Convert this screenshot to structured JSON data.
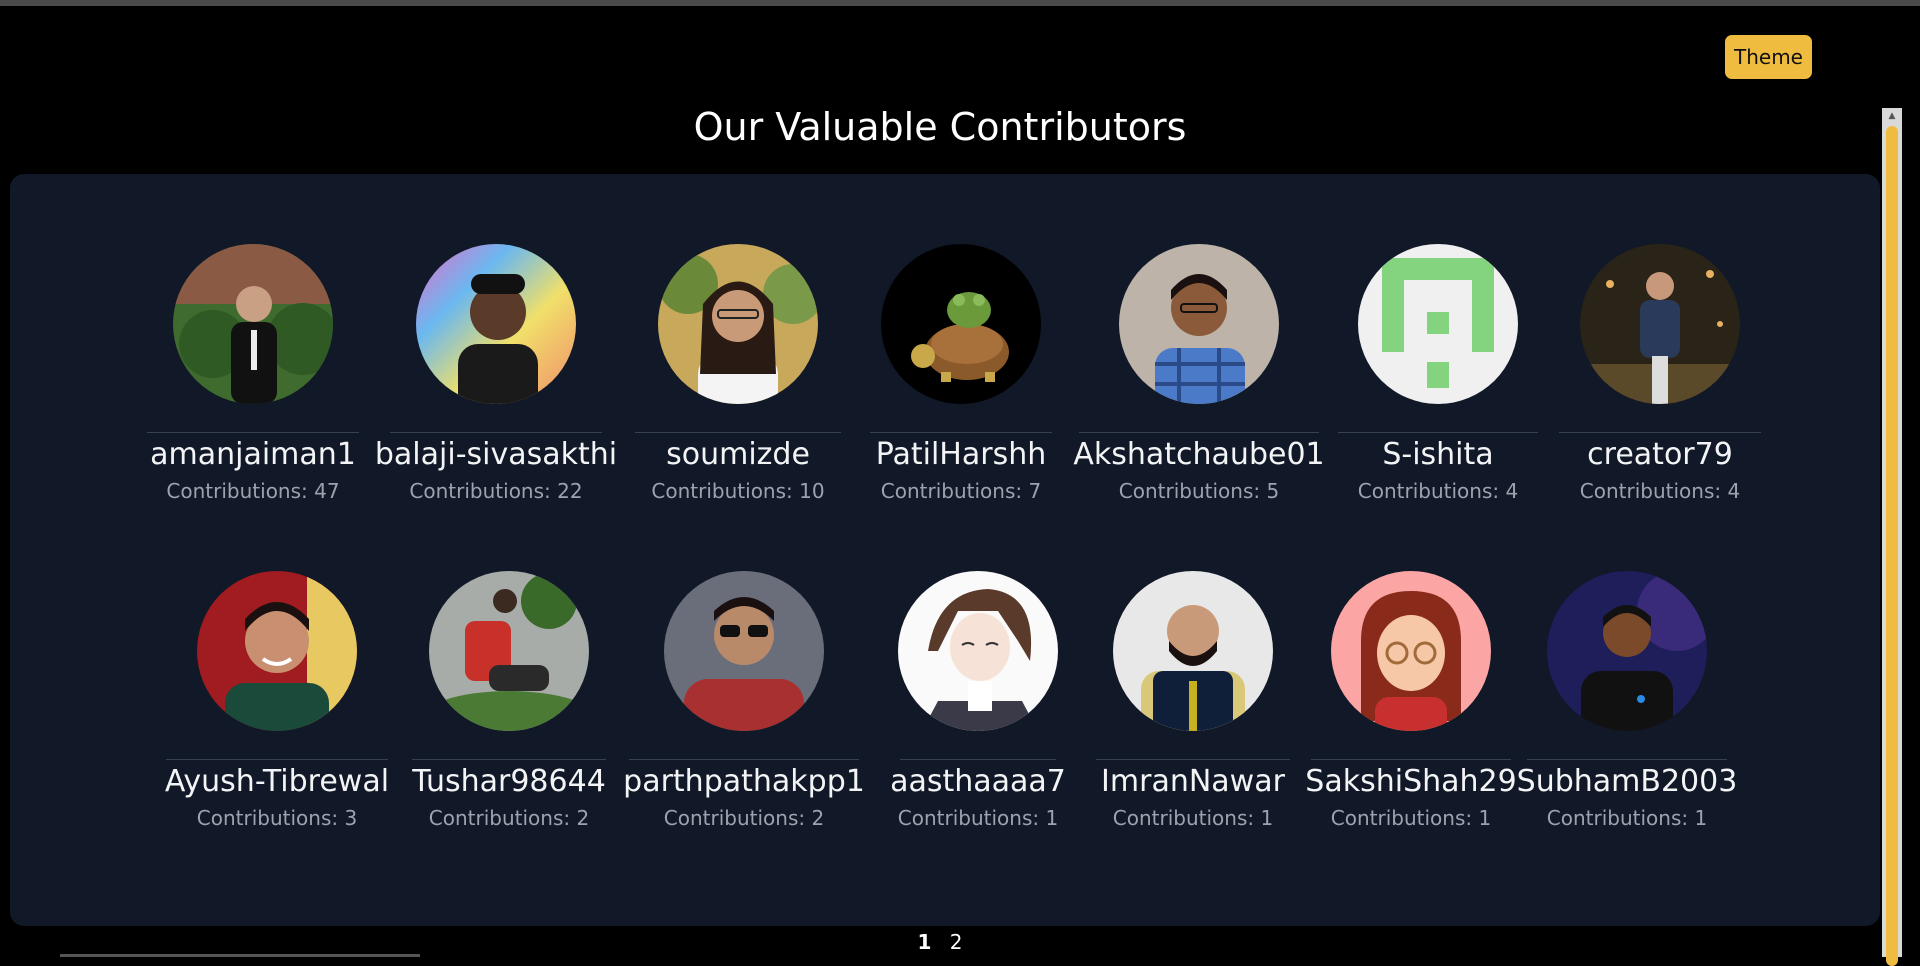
{
  "header": {
    "theme_button": "Theme",
    "title": "Our Valuable Contributors"
  },
  "contributors": [
    {
      "name": "amanjaiman1",
      "contributions": "Contributions: 47",
      "avatar_icon": "person-photo-avatar"
    },
    {
      "name": "balaji-sivasakthi",
      "contributions": "Contributions: 22",
      "avatar_icon": "person-photo-avatar"
    },
    {
      "name": "soumizde",
      "contributions": "Contributions: 10",
      "avatar_icon": "person-photo-avatar"
    },
    {
      "name": "PatilHarshh",
      "contributions": "Contributions: 7",
      "avatar_icon": "frog-on-turtle-avatar"
    },
    {
      "name": "Akshatchaube01",
      "contributions": "Contributions: 5",
      "avatar_icon": "person-photo-avatar"
    },
    {
      "name": "S-ishita",
      "contributions": "Contributions: 4",
      "avatar_icon": "identicon-avatar"
    },
    {
      "name": "creator79",
      "contributions": "Contributions: 4",
      "avatar_icon": "person-photo-avatar"
    },
    {
      "name": "Ayush-Tibrewal",
      "contributions": "Contributions: 3",
      "avatar_icon": "person-photo-avatar"
    },
    {
      "name": "Tushar98644",
      "contributions": "Contributions: 2",
      "avatar_icon": "person-photo-avatar"
    },
    {
      "name": "parthpathakpp1",
      "contributions": "Contributions: 2",
      "avatar_icon": "person-photo-avatar"
    },
    {
      "name": "aasthaaaa7",
      "contributions": "Contributions: 1",
      "avatar_icon": "anime-character-avatar"
    },
    {
      "name": "ImranNawar",
      "contributions": "Contributions: 1",
      "avatar_icon": "person-photo-avatar"
    },
    {
      "name": "SakshiShah29",
      "contributions": "Contributions: 1",
      "avatar_icon": "cartoon-girl-avatar"
    },
    {
      "name": "SubhamB2003",
      "contributions": "Contributions: 1",
      "avatar_icon": "person-photo-avatar"
    }
  ],
  "pagination": {
    "pages": [
      "1",
      "2"
    ],
    "current": "1"
  },
  "colors": {
    "background": "#000000",
    "panel": "#111827",
    "accent": "#f0bc3f",
    "muted_text": "#9ca3af"
  }
}
